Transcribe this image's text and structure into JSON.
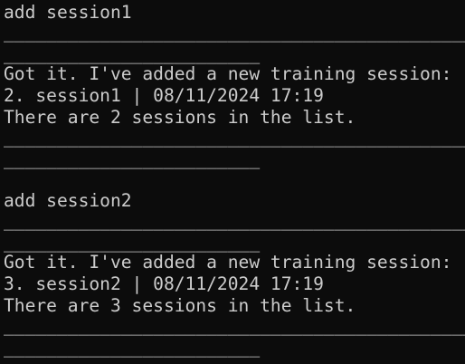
{
  "terminal": {
    "lines": [
      "add session1",
      "____________________________________________________________",
      "________________________",
      "Got it. I've added a new training session:",
      "2. session1 | 08/11/2024 17:19",
      "There are 2 sessions in the list.",
      "____________________________________________________________",
      "________________________",
      "",
      "add session2",
      "____________________________________________________________",
      "________________________",
      "Got it. I've added a new training session:",
      "3. session2 | 08/11/2024 17:19",
      "There are 3 sessions in the list.",
      "____________________________________________________________",
      "________________________"
    ]
  }
}
